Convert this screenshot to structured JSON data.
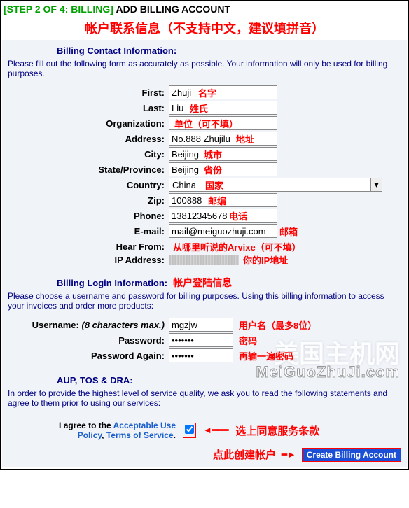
{
  "header": {
    "step": "[STEP 2 OF 4: BILLING]",
    "title": "ADD BILLING ACCOUNT",
    "annotation": "帐户联系信息（不支持中文，建议填拼音）"
  },
  "contact": {
    "heading": "Billing Contact Information:",
    "desc": "Please fill out the following form as accurately as possible. Your information will only be used for billing purposes.",
    "fields": {
      "first": {
        "label": "First:",
        "value": "Zhuji",
        "ann": "名字"
      },
      "last": {
        "label": "Last:",
        "value": "Liu",
        "ann": "姓氏"
      },
      "org": {
        "label": "Organization:",
        "value": "",
        "ann": "单位（可不填）"
      },
      "address": {
        "label": "Address:",
        "value": "No.888 Zhujilu",
        "ann": "地址"
      },
      "city": {
        "label": "City:",
        "value": "Beijing",
        "ann": "城市"
      },
      "state": {
        "label": "State/Province:",
        "value": "Beijing",
        "ann": "省份"
      },
      "country": {
        "label": "Country:",
        "value": "China",
        "ann": "国家"
      },
      "zip": {
        "label": "Zip:",
        "value": "100888",
        "ann": "邮编"
      },
      "phone": {
        "label": "Phone:",
        "value": "13812345678",
        "ann": "电话"
      },
      "email": {
        "label": "E-mail:",
        "value": "mail@meiguozhuji.com",
        "ann": "邮箱"
      },
      "hear": {
        "label": "Hear From:",
        "value": "",
        "ann": "从哪里听说的Arvixe（可不填）"
      },
      "ip": {
        "label": "IP Address:",
        "ann": "你的IP地址"
      }
    }
  },
  "login": {
    "heading": "Billing Login Information:",
    "heading_ann": "帐户登陆信息",
    "desc": "Please choose a username and password for billing purposes. Using this billing information to access your invoices and order more products:",
    "fields": {
      "username": {
        "label": "Username:",
        "hint": "(8 characters max.)",
        "value": "mgzjw",
        "ann": "用户名（最多8位）"
      },
      "password": {
        "label": "Password:",
        "value": "•••••••",
        "ann": "密码"
      },
      "password2": {
        "label": "Password Again:",
        "value": "•••••••",
        "ann": "再输一遍密码"
      }
    }
  },
  "terms": {
    "heading": "AUP, TOS & DRA:",
    "desc": "In order to provide the highest level of service quality, we ask you to read the following statements and agree to them prior to using our services:",
    "agree_prefix": "I agree to the ",
    "aup": "Acceptable Use Policy",
    "sep": ", ",
    "tos": "Terms of Service",
    "period": ".",
    "agree_ann": "选上同意服务条款"
  },
  "footer": {
    "ann": "点此创建帐户",
    "button": "Create Billing Account"
  },
  "watermark": {
    "cn": "美国主机网",
    "en": "MeiGuoZhuJi.com"
  }
}
